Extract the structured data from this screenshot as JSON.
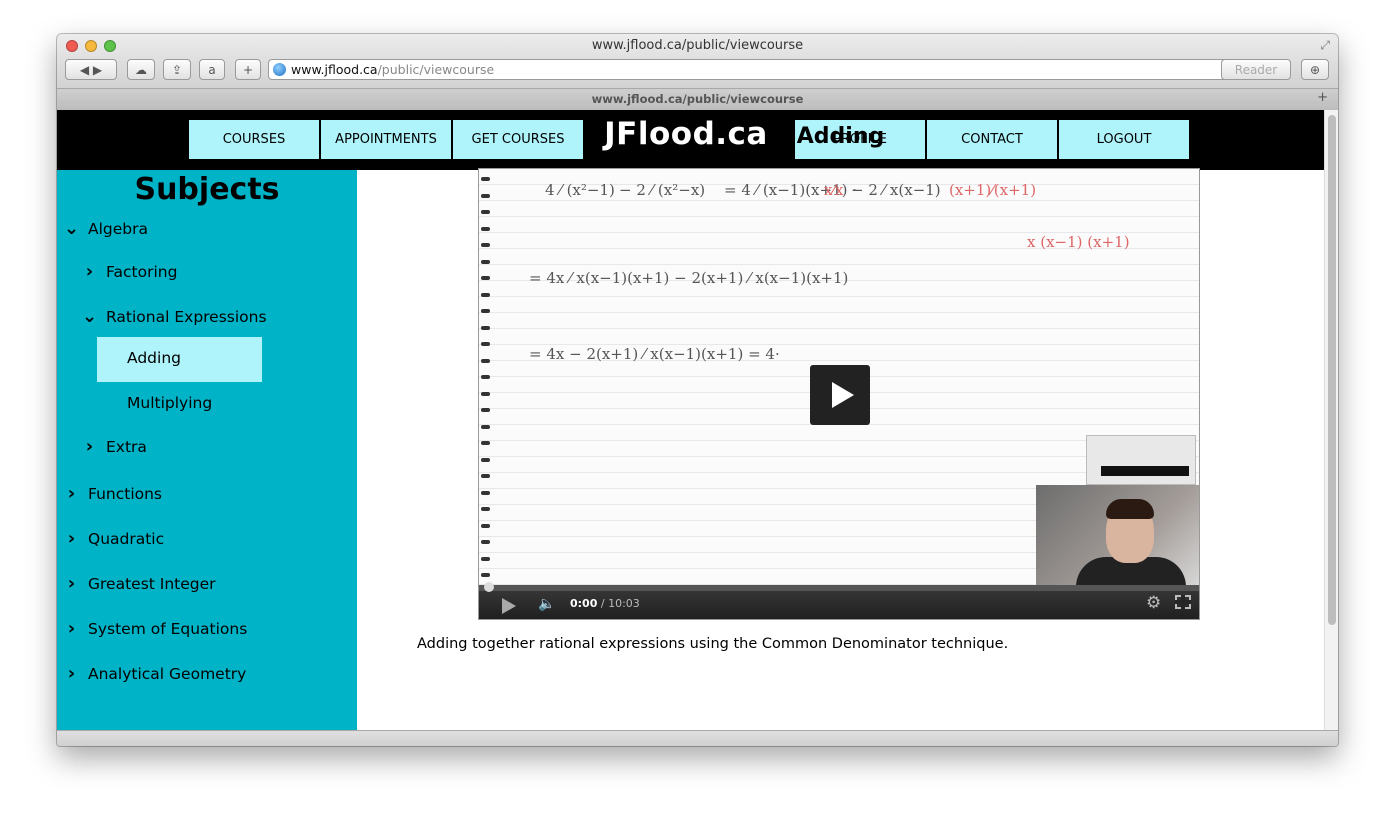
{
  "browser": {
    "window_title": "www.jflood.ca/public/viewcourse",
    "url_host": "www.jflood.ca",
    "url_path": "/public/viewcourse",
    "reader_label": "Reader",
    "tab_title": "www.jflood.ca/public/viewcourse"
  },
  "nav": {
    "left": [
      "COURSES",
      "APPOINTMENTS",
      "GET COURSES"
    ],
    "brand": "JFlood.ca",
    "right": [
      "PROFILE",
      "CONTACT",
      "LOGOUT"
    ]
  },
  "sidebar": {
    "title": "Subjects",
    "items": [
      {
        "label": "Algebra",
        "state": "expanded"
      },
      {
        "label": "Factoring",
        "state": "collapsed"
      },
      {
        "label": "Rational Expressions",
        "state": "expanded"
      },
      {
        "label": "Adding",
        "state": "active"
      },
      {
        "label": "Multiplying",
        "state": "leaf"
      },
      {
        "label": "Extra",
        "state": "collapsed"
      },
      {
        "label": "Functions",
        "state": "collapsed"
      },
      {
        "label": "Quadratic",
        "state": "collapsed"
      },
      {
        "label": "Greatest Integer",
        "state": "collapsed"
      },
      {
        "label": "System of Equations",
        "state": "collapsed"
      },
      {
        "label": "Analytical Geometry",
        "state": "collapsed"
      }
    ]
  },
  "content": {
    "title": "Adding",
    "video": {
      "current_time": "0:00",
      "duration": "/ 10:03",
      "progress": 0
    },
    "description": "Adding together rational expressions using the Common Denominator technique."
  },
  "colors": {
    "sidebar_bg": "#00b3c7",
    "nav_button_bg": "#aef4fa",
    "topbar_bg": "#000000"
  }
}
